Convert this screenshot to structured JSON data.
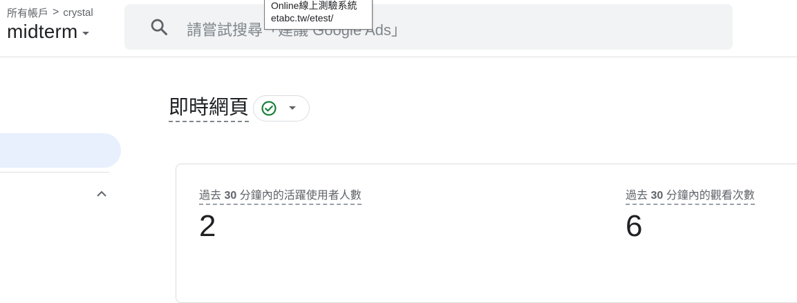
{
  "header": {
    "breadcrumb": {
      "root": "所有帳戶",
      "separator": ">",
      "account": "crystal"
    },
    "property_name": "midterm",
    "search_placeholder": "請嘗試搜尋「建議 Google Ads」"
  },
  "tooltip": {
    "line1": "Online線上測驗系統",
    "line2": "etabc.tw/etest/"
  },
  "page": {
    "title": "即時網頁",
    "status_icon": "check-circle-icon",
    "status_color": "#188038"
  },
  "metrics": [
    {
      "label_prefix": "過去",
      "label_number": "30",
      "label_suffix": "分鐘內的活躍使用者人數",
      "value": "2"
    },
    {
      "label_prefix": "過去",
      "label_number": "30",
      "label_suffix": "分鐘內的觀看次數",
      "value": "6"
    }
  ],
  "colors": {
    "sidebar_selected": "#e8f0fe",
    "search_bg": "#f1f3f4"
  }
}
